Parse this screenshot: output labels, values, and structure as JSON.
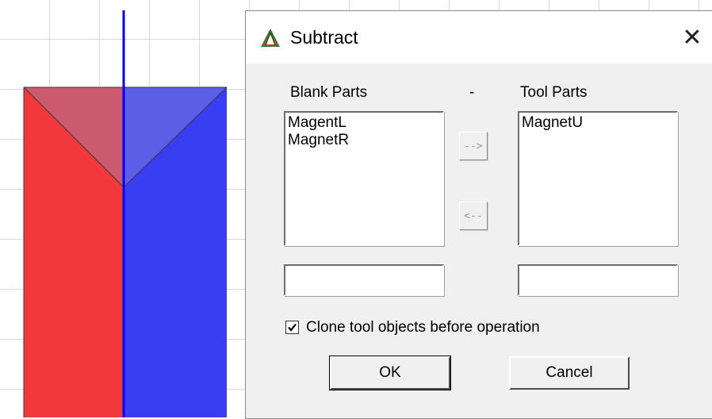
{
  "dialog": {
    "title": "Subtract",
    "close_glyph": "✕",
    "icon": "app-logo-icon",
    "blank_parts_label": "Blank Parts",
    "separator_label": "-",
    "tool_parts_label": "Tool Parts",
    "blank_parts": [
      "MagentL",
      "MagnetR"
    ],
    "tool_parts": [
      "MagnetU"
    ],
    "move_right_label": "-->",
    "move_left_label": "<--",
    "blank_input_value": "",
    "tool_input_value": "",
    "clone_checkbox_label": "Clone tool objects before operation",
    "clone_checked": true,
    "ok_label": "OK",
    "cancel_label": "Cancel"
  },
  "colors": {
    "red_part": "#f2383b",
    "blue_part": "#3a3ef2",
    "axis_line": "#0000ff",
    "tool_overlay": "#8a8fd8"
  }
}
